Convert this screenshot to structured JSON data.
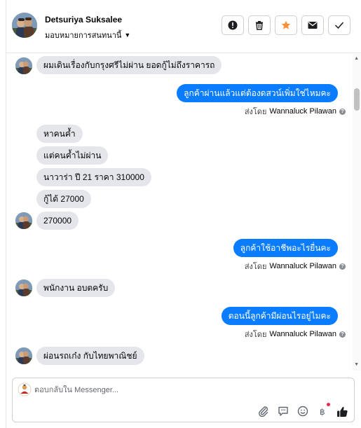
{
  "header": {
    "contact_name": "Detsuriya Suksalee",
    "assign_label": "มอบหมายการสนทนานี้",
    "actions": [
      {
        "name": "mark-spam-button",
        "icon": "alert-circle-icon"
      },
      {
        "name": "delete-button",
        "icon": "trash-icon"
      },
      {
        "name": "star-button",
        "icon": "star-icon"
      },
      {
        "name": "mark-unread-button",
        "icon": "envelope-icon"
      },
      {
        "name": "mark-done-button",
        "icon": "check-icon"
      }
    ]
  },
  "messages": [
    {
      "dir": "in",
      "text": "ผมเดินเรื่องกับกรุงศรีไม่ผ่าน  ยอดกู้ไม่ถึงราคารถ"
    },
    {
      "dir": "out",
      "text": "ลูกค้าผ่านแล้วแต่ต้องดสวน์เพิ่มใช่ไหมคะ",
      "sent_by_prefix": "ส่งโดย",
      "sent_by": "Wannaluck Pilawan"
    },
    {
      "dir": "in",
      "text": "หาคนค้ำ"
    },
    {
      "dir": "in",
      "text": "แต่คนค้ำไม่ผ่าน"
    },
    {
      "dir": "in",
      "text": "นาวาร่า ปี 21  ราคา 310000"
    },
    {
      "dir": "in",
      "text": "กู้ได้ 27000"
    },
    {
      "dir": "in",
      "text": "270000"
    },
    {
      "dir": "out",
      "text": "ลูกค้าใช้อาชีพอะไรยื่นคะ",
      "sent_by_prefix": "ส่งโดย",
      "sent_by": "Wannaluck Pilawan"
    },
    {
      "dir": "in",
      "text": "พนักงาน  อบตครับ"
    },
    {
      "dir": "out",
      "text": "ตอนนี้ลูกค้ามีผ่อนไรอยู่ไมคะ",
      "sent_by_prefix": "ส่งโดย",
      "sent_by": "Wannaluck Pilawan"
    },
    {
      "dir": "in",
      "text": "ผ่อนรถเก๋ง  กับไทยพาณิชย์"
    }
  ],
  "composer": {
    "placeholder": "ตอบกลับใน Messenger...",
    "value": "",
    "tools": [
      "paperclip-icon",
      "saved-reply-icon",
      "emoji-icon",
      "payment-icon",
      "thumbs-up-icon"
    ]
  },
  "colors": {
    "outgoing_bubble": "#0a7cff",
    "incoming_bubble": "#e4e6eb",
    "star": "#f7923a"
  }
}
